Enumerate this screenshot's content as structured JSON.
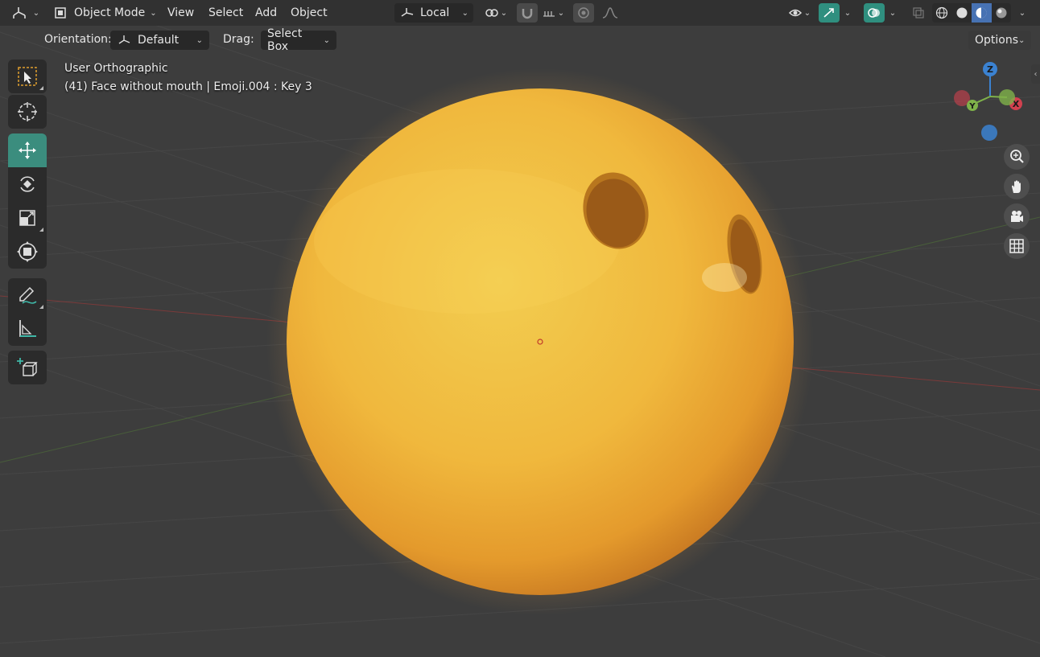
{
  "header": {
    "editor_type_icon": "3d-viewport-icon",
    "mode_label": "Object Mode",
    "menus": [
      "View",
      "Select",
      "Add",
      "Object"
    ],
    "transform_space_label": "Local",
    "options_label": "Options"
  },
  "tool_settings": {
    "orientation_label": "Orientation:",
    "orientation_value": "Default",
    "drag_label": "Drag:",
    "drag_value": "Select Box"
  },
  "viewport": {
    "view_name": "User Orthographic",
    "object_info": "(41) Face without mouth | Emoji.004 : Key 3"
  },
  "gizmo": {
    "x_label": "X",
    "y_label": "Y",
    "z_label": "Z",
    "colors": {
      "x": "#d1414f",
      "y": "#7fb24a",
      "z": "#3b82d1"
    }
  },
  "toolbar": {
    "tools": [
      "select-box-icon",
      "cursor-icon",
      "move-icon",
      "rotate-icon",
      "scale-icon",
      "transform-icon",
      "annotate-icon",
      "measure-icon",
      "add-cube-icon"
    ],
    "active_tool": "move-icon"
  },
  "colors": {
    "background": "#3d3d3d",
    "accent": "#3b8d7e",
    "selection_blue": "#4772b3",
    "sphere": "#f3b73c"
  }
}
